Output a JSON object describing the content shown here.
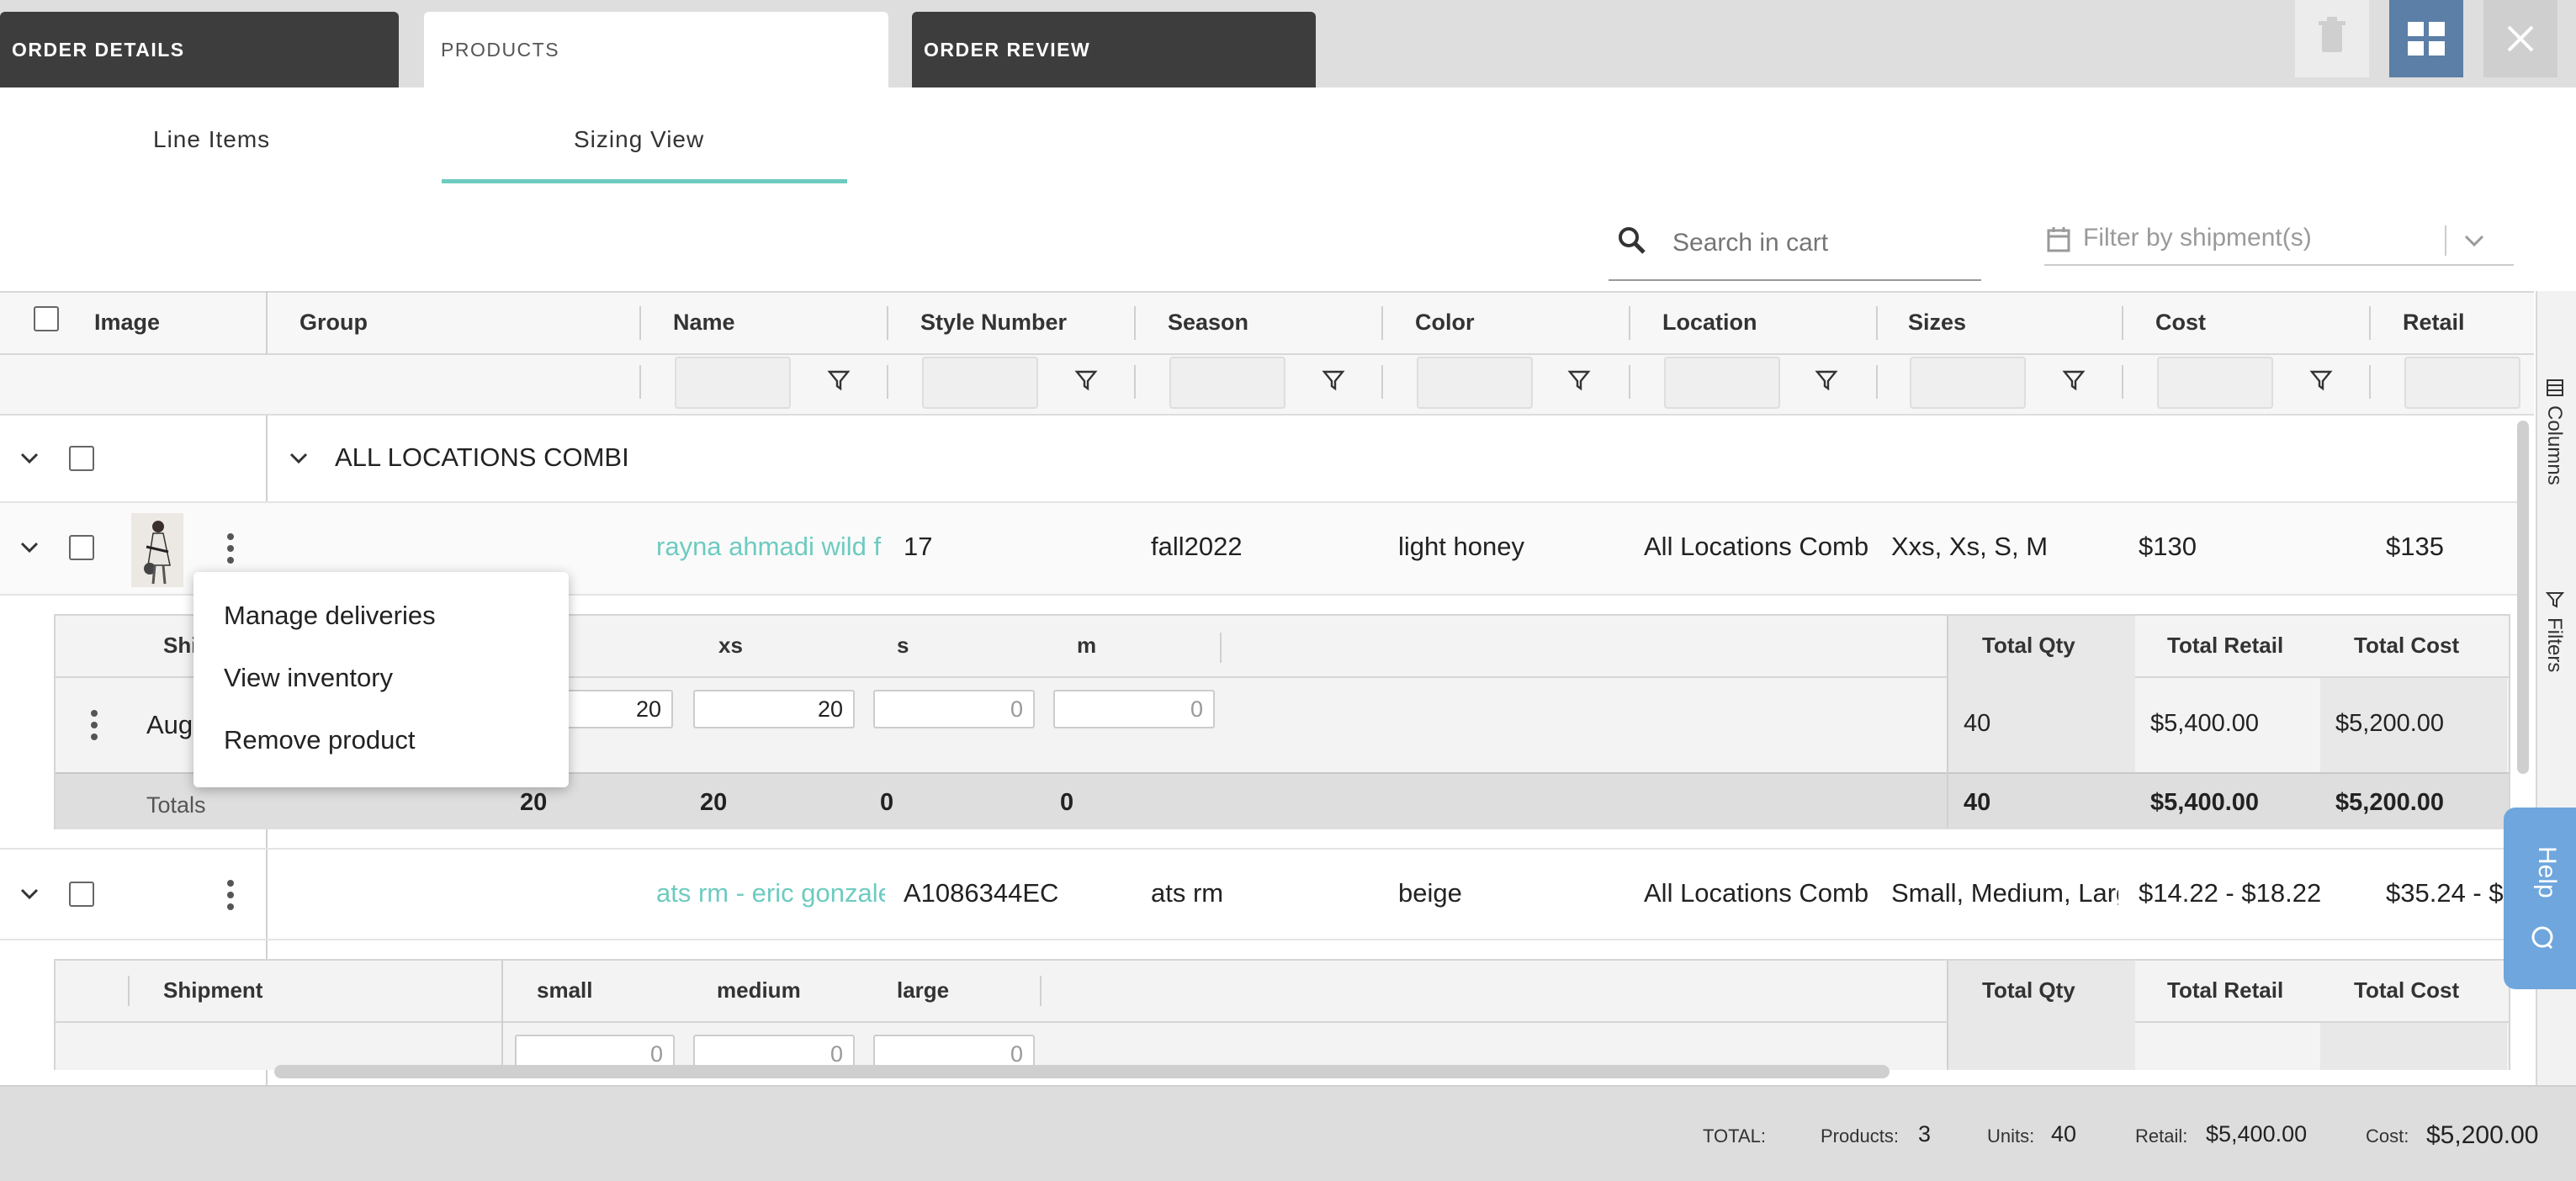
{
  "tabs": {
    "order_details": "ORDER DETAILS",
    "products": "PRODUCTS",
    "order_review": "ORDER REVIEW"
  },
  "subtabs": {
    "line_items": "Line Items",
    "sizing_view": "Sizing View"
  },
  "search": {
    "placeholder": "Search in cart"
  },
  "filter_shipments": {
    "placeholder": "Filter by shipment(s)"
  },
  "columns": {
    "image": "Image",
    "group": "Group",
    "name": "Name",
    "style_number": "Style Number",
    "season": "Season",
    "color": "Color",
    "location": "Location",
    "sizes": "Sizes",
    "cost": "Cost",
    "retail": "Retail"
  },
  "group_row": {
    "label": "ALL LOCATIONS COMBI"
  },
  "products": [
    {
      "name": "rayna ahmadi wild f",
      "style": "17",
      "season": "fall2022",
      "color": "light honey",
      "location": "All Locations Comb",
      "sizes": "Xxs, Xs, S, M",
      "cost": "$130",
      "retail": "$135"
    },
    {
      "name": "ats rm - eric gonzale",
      "style": "A1086344EC",
      "season": "ats rm",
      "color": "beige",
      "location": "All Locations Comb",
      "sizes": "Small, Medium, Larg",
      "cost": "$14.22 - $18.22",
      "retail": "$35.24 - $"
    }
  ],
  "sizing1": {
    "header_shipment": "Shi",
    "header_xxs": "s",
    "header_xs": "xs",
    "header_s": "s",
    "header_m": "m",
    "row_shipment": "Aug",
    "qty": [
      "20",
      "20",
      "0",
      "0"
    ],
    "totals_label": "Totals",
    "totals": [
      "20",
      "20",
      "0",
      "0"
    ],
    "total_qty_label": "Total Qty",
    "total_retail_label": "Total Retail",
    "total_cost_label": "Total Cost",
    "row_total_qty": "40",
    "row_total_retail": "$5,400.00",
    "row_total_cost": "$5,200.00",
    "sum_total_qty": "40",
    "sum_total_retail": "$5,400.00",
    "sum_total_cost": "$5,200.00"
  },
  "sizing2": {
    "header_shipment": "Shipment",
    "header_small": "small",
    "header_medium": "medium",
    "header_large": "large",
    "qty": [
      "0",
      "0",
      "0"
    ],
    "total_qty_label": "Total Qty",
    "total_retail_label": "Total Retail",
    "total_cost_label": "Total Cost"
  },
  "context_menu": {
    "manage_deliveries": "Manage deliveries",
    "view_inventory": "View inventory",
    "remove_product": "Remove product"
  },
  "side_panel": {
    "columns": "Columns",
    "filters": "Filters",
    "help": "Help"
  },
  "footer": {
    "total_label": "TOTAL:",
    "products_label": "Products:",
    "products_value": "3",
    "units_label": "Units:",
    "units_value": "40",
    "retail_label": "Retail:",
    "retail_value": "$5,400.00",
    "cost_label": "Cost:",
    "cost_value": "$5,200.00"
  },
  "colors": {
    "accent": "#6ecbc0",
    "toolbar_blue": "#5b7fa6",
    "dark_tab": "#3d3d3d",
    "help_blue": "#6ea6dd"
  }
}
